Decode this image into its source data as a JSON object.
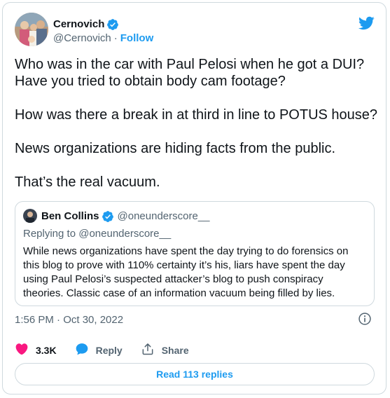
{
  "tweet": {
    "author_name": "Cernovich",
    "author_handle": "@Cernovich",
    "follow_label": "Follow",
    "separator": "·",
    "paragraphs": [
      "Who was in the car with Paul Pelosi when he got a DUI? Have you tried to obtain body cam footage?",
      "How was there a break in at third in line to POTUS house?",
      "News organizations are hiding facts from the public.",
      "That’s the real vacuum."
    ],
    "timestamp": "1:56 PM · Oct 30, 2022",
    "likes_count": "3.3K",
    "reply_label": "Reply",
    "share_label": "Share",
    "read_replies_label": "Read 113 replies"
  },
  "quote": {
    "author_name": "Ben Collins",
    "author_handle": "@oneunderscore__",
    "replying_prefix": "Replying to ",
    "replying_handle": "@oneunderscore__",
    "text": "While news organizations have spent the day trying to do forensics on this blog to prove with 110% certainty it’s his, liars have spent the day using Paul Pelosi’s suspected attacker’s blog to push conspiracy theories. Classic case of an information vacuum being filled by lies."
  },
  "colors": {
    "accent": "#1d9bf0",
    "like": "#f91880",
    "muted": "#536471",
    "border": "#cfd9de"
  },
  "icons": [
    "verified-badge-icon",
    "twitter-bird-icon",
    "info-icon",
    "heart-icon",
    "reply-bubble-icon",
    "share-icon"
  ]
}
